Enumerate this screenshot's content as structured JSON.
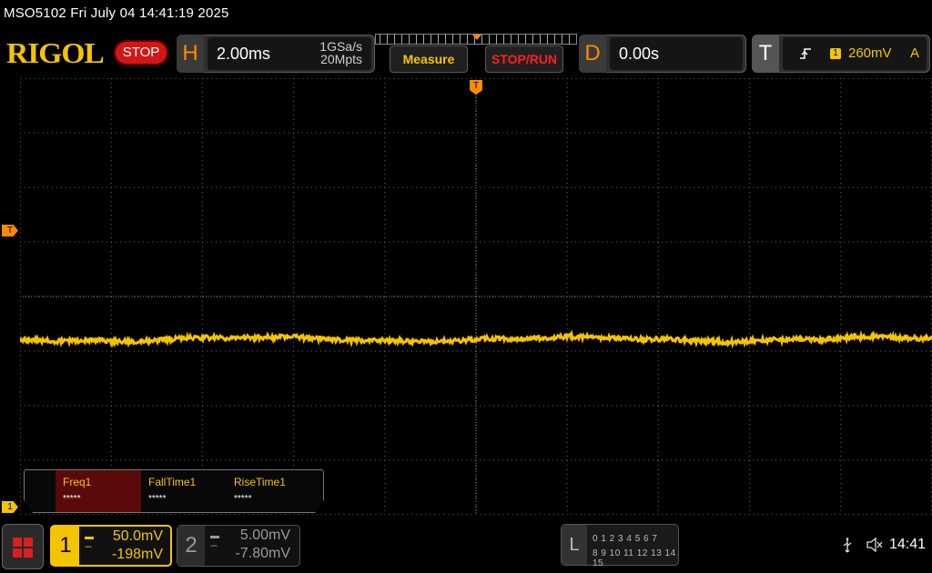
{
  "status_bar": {
    "title": "MSO5102  Fri July 04 14:41:19 2025"
  },
  "brand": {
    "logo": "RIGOL",
    "run_state": "STOP"
  },
  "horizontal": {
    "letter": "H",
    "timebase": "2.00ms",
    "sample_rate": "1GSa/s",
    "memory_depth": "20Mpts"
  },
  "buttons": {
    "measure": "Measure",
    "stop_run": "STOP/RUN"
  },
  "delay": {
    "letter": "D",
    "value": "0.00s"
  },
  "trigger": {
    "letter": "T",
    "source": "1",
    "level": "260mV",
    "mode": "A",
    "edge_icon": "rising-edge-icon"
  },
  "screen_markers": {
    "trigger_level": "T",
    "trigger_position": "T",
    "ch1_ground": "1"
  },
  "measurements": [
    {
      "name": "Freq1",
      "value": "*****"
    },
    {
      "name": "FallTime1",
      "value": "*****"
    },
    {
      "name": "RiseTime1",
      "value": "*****"
    }
  ],
  "channels": {
    "ch1": {
      "number": "1",
      "coupling_icon": "dc-coupling-icon",
      "scale": "50.0mV",
      "offset": "-198mV",
      "color": "#f5c400"
    },
    "ch2": {
      "number": "2",
      "coupling_icon": "dc-coupling-icon",
      "scale": "5.00mV",
      "offset": "-7.80mV",
      "color": "#9a9a9a"
    }
  },
  "logic": {
    "letter": "L",
    "row1": "0 1 2 3   4 5 6 7",
    "row2": "8  9 10 11  12 13 14 15"
  },
  "system": {
    "usb_icon": "usb-icon",
    "speaker_icon": "speaker-muted-icon",
    "time": "14:41"
  },
  "colors": {
    "ch1": "#f5c400",
    "accent": "#ff8a00",
    "stop": "#d01818"
  }
}
